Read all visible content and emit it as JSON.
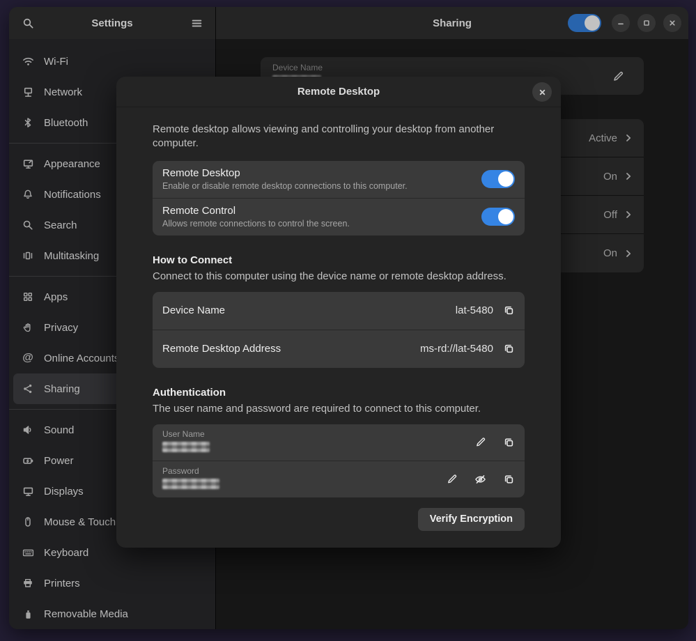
{
  "colors": {
    "desktop_bg": "#221d33",
    "accent_blue": "#3584e4",
    "window_bg": "#1e1e1e",
    "headerbar_bg": "#303030",
    "dialog_bg": "#242424",
    "card_bg": "#3a3a3a"
  },
  "header_left": {
    "title": "Settings"
  },
  "header_right": {
    "title": "Sharing",
    "toggle_on": true
  },
  "sidebar": {
    "groups": [
      {
        "items": [
          {
            "icon": "wifi-icon",
            "label": "Wi-Fi"
          },
          {
            "icon": "network-icon",
            "label": "Network"
          },
          {
            "icon": "bluetooth-icon",
            "label": "Bluetooth"
          }
        ]
      },
      {
        "items": [
          {
            "icon": "appearance-icon",
            "label": "Appearance"
          },
          {
            "icon": "notifications-icon",
            "label": "Notifications"
          },
          {
            "icon": "search-icon",
            "label": "Search"
          },
          {
            "icon": "multitasking-icon",
            "label": "Multitasking"
          }
        ]
      },
      {
        "items": [
          {
            "icon": "apps-icon",
            "label": "Apps"
          },
          {
            "icon": "privacy-icon",
            "label": "Privacy"
          },
          {
            "icon": "online-accounts-icon",
            "label": "Online Accounts"
          },
          {
            "icon": "sharing-icon",
            "label": "Sharing",
            "selected": true
          }
        ]
      },
      {
        "items": [
          {
            "icon": "sound-icon",
            "label": "Sound"
          },
          {
            "icon": "power-icon",
            "label": "Power"
          },
          {
            "icon": "displays-icon",
            "label": "Displays"
          },
          {
            "icon": "mouse-icon",
            "label": "Mouse & Touchpad"
          },
          {
            "icon": "keyboard-icon",
            "label": "Keyboard"
          },
          {
            "icon": "printers-icon",
            "label": "Printers"
          },
          {
            "icon": "removable-media-icon",
            "label": "Removable Media"
          }
        ]
      }
    ]
  },
  "background_panel": {
    "device_name_label": "Device Name",
    "device_name_redacted": true,
    "status_rows": [
      {
        "status": "Active"
      },
      {
        "status": "On"
      },
      {
        "status": "Off"
      },
      {
        "status": "On"
      }
    ]
  },
  "dialog": {
    "title": "Remote Desktop",
    "description": "Remote desktop allows viewing and controlling your desktop from another computer.",
    "toggles": [
      {
        "title": "Remote Desktop",
        "subtitle": "Enable or disable remote desktop connections to this computer.",
        "on": true
      },
      {
        "title": "Remote Control",
        "subtitle": "Allows remote connections to control the screen.",
        "on": true
      }
    ],
    "how_to_connect": {
      "heading": "How to Connect",
      "description": "Connect to this computer using the device name or remote desktop address.",
      "rows": [
        {
          "label": "Device Name",
          "value": "lat-5480"
        },
        {
          "label": "Remote Desktop Address",
          "value": "ms-rd://lat-5480"
        }
      ]
    },
    "authentication": {
      "heading": "Authentication",
      "description": "The user name and password are required to connect to this computer.",
      "fields": [
        {
          "label": "User Name",
          "redacted": true
        },
        {
          "label": "Password",
          "redacted": true
        }
      ]
    },
    "verify_button": "Verify Encryption"
  }
}
